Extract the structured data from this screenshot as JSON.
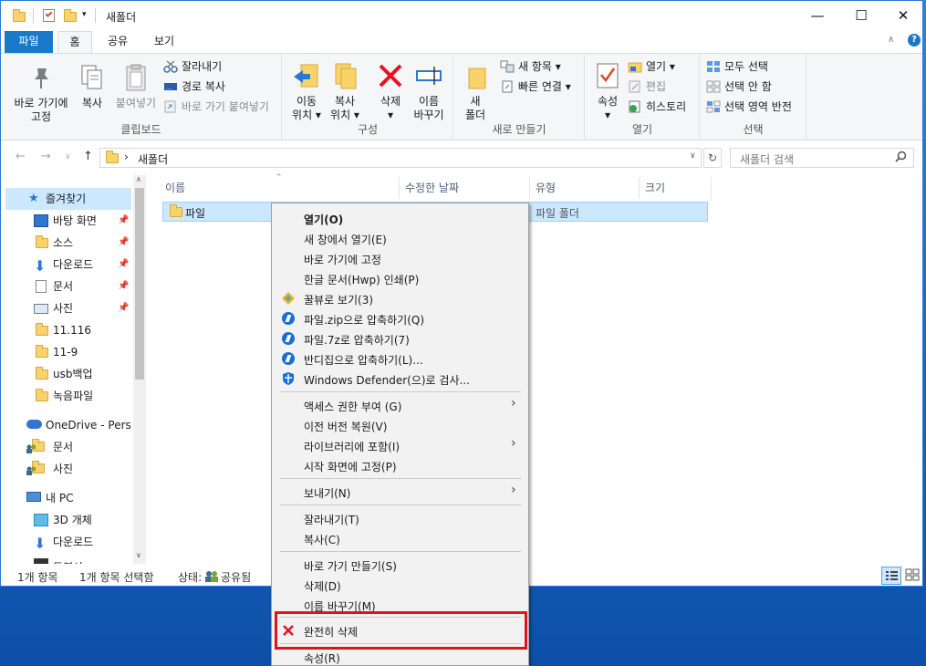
{
  "title": {
    "text": "새폴더"
  },
  "window_controls": {
    "min": "—",
    "max": "☐",
    "close": "✕"
  },
  "tabs": {
    "file": "파일",
    "home": "홈",
    "share": "공유",
    "view": "보기"
  },
  "ribbon": {
    "clipboard": {
      "label": "클립보드",
      "pin_line1": "바로 가기에",
      "pin_line2": "고정",
      "copy": "복사",
      "paste": "붙여넣기",
      "cut": "잘라내기",
      "copy_path": "경로 복사",
      "paste_shortcut": "바로 가기 붙여넣기"
    },
    "organize": {
      "label": "구성",
      "move_line1": "이동",
      "move_line2": "위치 ▾",
      "copy_line1": "복사",
      "copy_line2": "위치 ▾",
      "delete_line1": "삭제",
      "delete_line2": "▾",
      "rename_line1": "이름",
      "rename_line2": "바꾸기"
    },
    "new": {
      "label": "새로 만들기",
      "folder_line1": "새",
      "folder_line2": "폴더",
      "new_item": "새 항목 ▾",
      "easy_access": "빠른 연결 ▾"
    },
    "open": {
      "label": "열기",
      "props_line1": "속성",
      "props_line2": "▾",
      "open": "열기 ▾",
      "edit": "편집",
      "history": "히스토리"
    },
    "select": {
      "label": "선택",
      "all": "모두 선택",
      "none": "선택 안 함",
      "invert": "선택 영역 반전"
    }
  },
  "address": {
    "back": "←",
    "forward": "→",
    "up": "↑",
    "sep": "›",
    "path": "새폴더",
    "dropdown": "∨",
    "refresh": "↻",
    "search_placeholder": "새폴더 검색"
  },
  "nav": {
    "quick_access": "즐겨찾기",
    "items": [
      "바탕 화면",
      "소스",
      "다운로드",
      "문서",
      "사진",
      "11.116",
      "11-9",
      "usb백업",
      "녹음파일"
    ],
    "onedrive": "OneDrive - Person",
    "od_items": [
      "문서",
      "사진"
    ],
    "pc": "내 PC",
    "pc_items": [
      "3D 개체",
      "다운로드",
      "동영상"
    ]
  },
  "columns": {
    "name": "이름",
    "date": "수정한 날짜",
    "type": "유형",
    "size": "크기"
  },
  "files": [
    {
      "name": "파일",
      "type": "파일 폴더"
    }
  ],
  "status": {
    "count": "1개 항목",
    "selected": "1개 항목 선택함",
    "state": "상태:",
    "shared": "공유됨"
  },
  "context_menu": {
    "open": "열기(O)",
    "open_new": "새 창에서 열기(E)",
    "pin_quick": "바로 가기에 고정",
    "print_hwp": "한글 문서(Hwp) 인쇄(P)",
    "honeyview": "꿀뷰로 보기(3)",
    "zip": "파일.zip으로 압축하기(Q)",
    "sevenzip": "파일.7z로 압축하기(7)",
    "bandizip": "반디집으로 압축하기(L)...",
    "defender": "Windows Defender(으)로 검사...",
    "give_access": "액세스 권한 부여 (G)",
    "restore": "이전 버전 복원(V)",
    "library": "라이브러리에 포함(I)",
    "pin_start": "시작 화면에 고정(P)",
    "send_to": "보내기(N)",
    "cut": "잘라내기(T)",
    "copy": "복사(C)",
    "create_shortcut": "바로 가기 만들기(S)",
    "delete": "삭제(D)",
    "rename": "이름 바꾸기(M)",
    "perm_delete": "완전히 삭제",
    "properties": "속성(R)"
  },
  "colors": {
    "accent": "#1979ca",
    "selection": "#cce8ff",
    "highlight_box": "#e0131b",
    "delete_x": "#e81123",
    "folder": "#f8d26a"
  }
}
